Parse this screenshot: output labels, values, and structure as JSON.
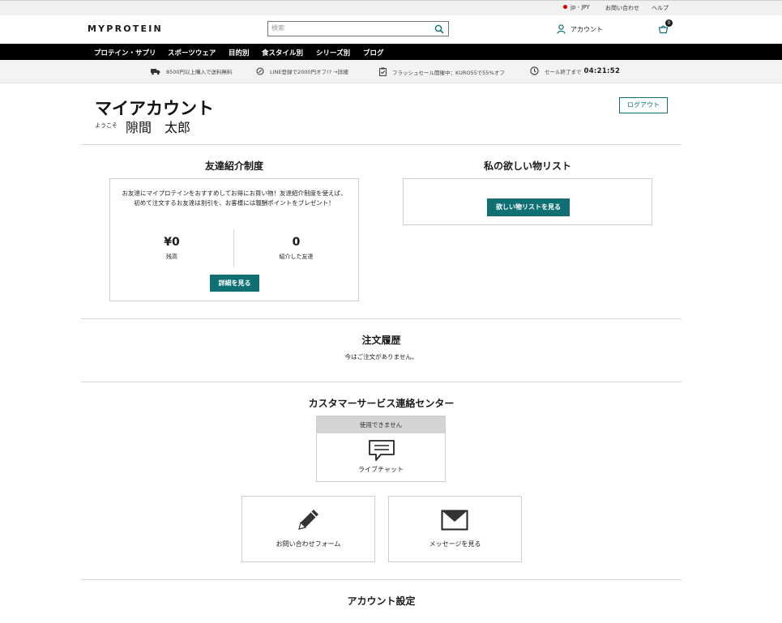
{
  "utility_bar": {
    "locale": "jp - JPY",
    "contact": "お問い合わせ",
    "help": "ヘルプ"
  },
  "header": {
    "logo": "MYPROTEIN",
    "search_placeholder": "検索",
    "account_label": "アカウント",
    "basket_count": "0"
  },
  "nav": {
    "items": [
      {
        "label": "プロテイン・サプリ"
      },
      {
        "label": "スポーツウェア"
      },
      {
        "label": "目的別"
      },
      {
        "label": "食スタイル別"
      },
      {
        "label": "シリーズ別"
      },
      {
        "label": "ブログ"
      }
    ]
  },
  "promo": {
    "shipping": "8500円以上購入で送料無料",
    "line": "LINE登録で2000円オフ!? →詳細",
    "flash_sale": "フラッシュセール開催中：KURO55で55%オフ",
    "sale_end_label": "セール終了まで",
    "countdown": "04:21:52"
  },
  "account": {
    "title": "マイアカウント",
    "welcome": "ようこそ",
    "name": "隙間　太郎",
    "logout": "ログアウト"
  },
  "referral": {
    "title": "友達紹介制度",
    "description": "お友達にマイプロテインをおすすめしてお得にお買い物！友達紹介制度を使えば、初めて注文するお友達は割引を、お客様には報酬ポイントをプレゼント！",
    "balance_value": "¥0",
    "balance_label": "残高",
    "friends_value": "0",
    "friends_label": "紹介した友達",
    "details_button": "詳細を見る"
  },
  "wishlist": {
    "title": "私の欲しい物リスト",
    "button": "欲しい物リストを見る"
  },
  "orders": {
    "title": "注文履歴",
    "empty": "今はご注文がありません。"
  },
  "customer_service": {
    "title": "カスタマーサービス連絡センター",
    "unavailable": "使用できません",
    "live_chat": "ライブチャット",
    "contact_form": "お問い合わせフォーム",
    "messages": "メッセージを見る"
  },
  "settings": {
    "title": "アカウント設定"
  },
  "colors": {
    "teal": "#0f6f73",
    "nav_bg": "#000000",
    "promo_bg": "#f3f3f3",
    "unavailable_bg": "#d4d4d4"
  },
  "icons": [
    "search-icon",
    "user-icon",
    "basket-icon",
    "truck-icon",
    "line-icon",
    "clipboard-icon",
    "clock-icon",
    "chat-icon",
    "pencil-icon",
    "envelope-icon"
  ]
}
